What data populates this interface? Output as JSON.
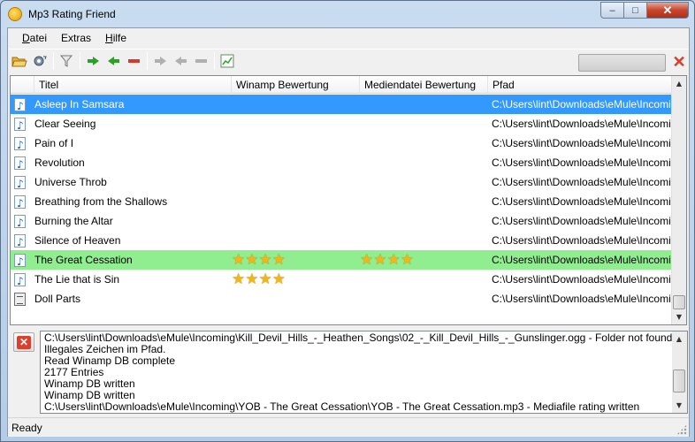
{
  "window": {
    "title": "Mp3 Rating Friend",
    "min_glyph": "–",
    "max_glyph": "□",
    "close_glyph": "✕"
  },
  "menu": [
    {
      "label": "Datei",
      "mnemonic": "D",
      "rest": "atei"
    },
    {
      "label": "Extras",
      "mnemonic": "",
      "rest": "Extras"
    },
    {
      "label": "Hilfe",
      "mnemonic": "H",
      "rest": "ilfe"
    }
  ],
  "toolbar": {
    "icons": [
      "folder-open-icon",
      "gear-sync-icon",
      "filter-icon",
      "arrow-right-icon",
      "arrow-left-icon",
      "remove-icon",
      "arrow-right-disabled-icon",
      "arrow-left-disabled-icon",
      "remove-disabled-icon",
      "chart-icon"
    ],
    "cancel_glyph": "✕",
    "accent_green": "#2aa127",
    "accent_red": "#d8372a"
  },
  "list": {
    "columns": [
      "Titel",
      "Winamp Bewertung",
      "Mediendatei Bewertung",
      "Pfad"
    ],
    "rows": [
      {
        "title": "Asleep In Samsara",
        "winamp": 0,
        "media": 0,
        "path": "C:\\Users\\lint\\Downloads\\eMule\\Incomi...",
        "icon": "music-file-icon",
        "state": "selected"
      },
      {
        "title": "Clear Seeing",
        "winamp": 0,
        "media": 0,
        "path": "C:\\Users\\lint\\Downloads\\eMule\\Incomi...",
        "icon": "music-file-icon",
        "state": ""
      },
      {
        "title": "Pain of I",
        "winamp": 0,
        "media": 0,
        "path": "C:\\Users\\lint\\Downloads\\eMule\\Incomi...",
        "icon": "music-file-icon",
        "state": ""
      },
      {
        "title": "Revolution",
        "winamp": 0,
        "media": 0,
        "path": "C:\\Users\\lint\\Downloads\\eMule\\Incomi...",
        "icon": "music-file-icon",
        "state": ""
      },
      {
        "title": "Universe Throb",
        "winamp": 0,
        "media": 0,
        "path": "C:\\Users\\lint\\Downloads\\eMule\\Incomi...",
        "icon": "music-file-icon",
        "state": ""
      },
      {
        "title": "Breathing from the Shallows",
        "winamp": 0,
        "media": 0,
        "path": "C:\\Users\\lint\\Downloads\\eMule\\Incomi...",
        "icon": "music-file-icon",
        "state": ""
      },
      {
        "title": "Burning the Altar",
        "winamp": 0,
        "media": 0,
        "path": "C:\\Users\\lint\\Downloads\\eMule\\Incomi...",
        "icon": "music-file-icon",
        "state": ""
      },
      {
        "title": "Silence of Heaven",
        "winamp": 0,
        "media": 0,
        "path": "C:\\Users\\lint\\Downloads\\eMule\\Incomi...",
        "icon": "music-file-icon",
        "state": ""
      },
      {
        "title": "The Great Cessation",
        "winamp": 4,
        "media": 4,
        "path": "C:\\Users\\lint\\Downloads\\eMule\\Incomi...",
        "icon": "music-file-icon",
        "state": "highlight"
      },
      {
        "title": "The Lie that is Sin",
        "winamp": 4,
        "media": 0,
        "path": "C:\\Users\\lint\\Downloads\\eMule\\Incomi...",
        "icon": "music-file-icon",
        "state": ""
      },
      {
        "title": "Doll Parts",
        "winamp": 0,
        "media": 0,
        "path": "C:\\Users\\lint\\Downloads\\eMule\\Incomi...",
        "icon": "generic-file-icon",
        "state": ""
      }
    ],
    "selected_color": "#3399ff",
    "highlight_color": "#90ee90",
    "star_color": "#f2b616"
  },
  "log": {
    "lines": [
      "C:\\Users\\lint\\Downloads\\eMule\\Incoming\\Kill_Devil_Hills_-_Heathen_Songs\\02_-_Kill_Devil_Hills_-_Gunslinger.ogg - Folder not found",
      "Illegales Zeichen im Pfad.",
      "Read Winamp DB complete",
      "2177 Entries",
      "Winamp DB written",
      "Winamp DB written",
      "C:\\Users\\lint\\Downloads\\eMule\\Incoming\\YOB - The Great Cessation\\YOB - The Great Cessation.mp3 - Mediafile rating written"
    ],
    "clear_glyph": "✕"
  },
  "status": {
    "text": "Ready"
  },
  "scroll": {
    "up_glyph": "▲",
    "down_glyph": "▼"
  }
}
